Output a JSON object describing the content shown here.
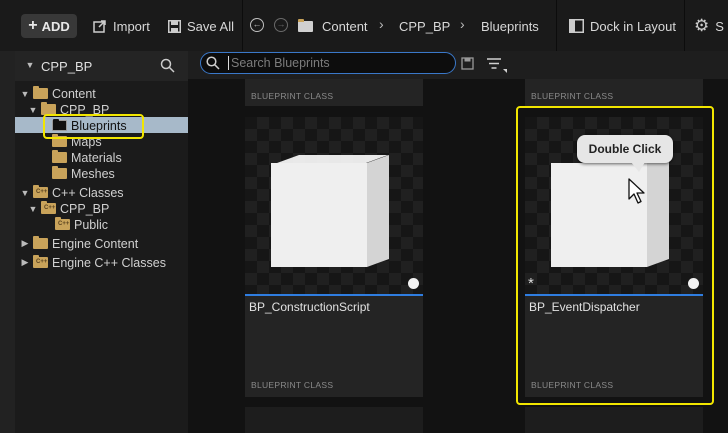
{
  "toolbar": {
    "add_label": "ADD",
    "import_label": "Import",
    "save_all_label": "Save All",
    "dock_label": "Dock in Layout",
    "breadcrumb": [
      "Content",
      "CPP_BP",
      "Blueprints"
    ]
  },
  "left_panel": {
    "title": "CPP_BP",
    "tree": {
      "content": "Content",
      "cpp_bp": "CPP_BP",
      "blueprints": "Blueprints",
      "maps": "Maps",
      "materials": "Materials",
      "meshes": "Meshes",
      "cpp_classes": "C++ Classes",
      "cpp_classes_cpp_bp": "CPP_BP",
      "public": "Public",
      "engine_content": "Engine Content",
      "engine_cpp_classes": "Engine C++ Classes"
    }
  },
  "search": {
    "placeholder": "Search Blueprints"
  },
  "assets": {
    "top_class_1": "BLUEPRINT CLASS",
    "top_class_2": "BLUEPRINT CLASS",
    "cards": [
      {
        "name": "BP_ConstructionScript",
        "class": "BLUEPRINT CLASS"
      },
      {
        "name": "BP_EventDispatcher",
        "class": "BLUEPRINT CLASS"
      }
    ]
  },
  "tooltip": {
    "text": "Double Click"
  },
  "colors": {
    "highlight": "#f2e600",
    "accent": "#2f7de0",
    "folder": "#c9a35a"
  }
}
